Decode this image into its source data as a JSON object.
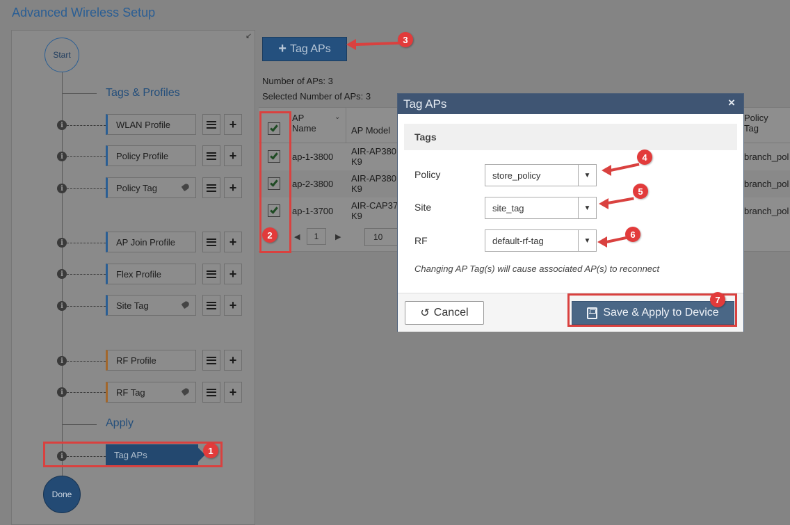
{
  "page": {
    "title": "Advanced Wireless Setup"
  },
  "wizard": {
    "start_label": "Start",
    "done_label": "Done",
    "sections": {
      "tags_profiles": "Tags & Profiles",
      "apply": "Apply"
    },
    "steps": [
      {
        "label": "WLAN Profile",
        "accent": "#2a5e94",
        "tag_icon": false
      },
      {
        "label": "Policy Profile",
        "accent": "#2a5e94",
        "tag_icon": false
      },
      {
        "label": "Policy Tag",
        "accent": "#2a5e94",
        "tag_icon": true
      },
      {
        "label": "AP Join Profile",
        "accent": "#2a5e94",
        "tag_icon": false
      },
      {
        "label": "Flex Profile",
        "accent": "#2a5e94",
        "tag_icon": false
      },
      {
        "label": "Site Tag",
        "accent": "#2a5e94",
        "tag_icon": true
      },
      {
        "label": "RF Profile",
        "accent": "#a2672c",
        "tag_icon": false
      },
      {
        "label": "RF Tag",
        "accent": "#a2672c",
        "tag_icon": true
      }
    ],
    "active_step": "Tag APs",
    "step_info_icon": "i"
  },
  "main": {
    "tag_aps_button": "Tag APs",
    "ap_count": "Number of APs: 3",
    "selected_count": "Selected Number of APs: 3",
    "table": {
      "headers": {
        "ap_name_line1": "AP",
        "ap_name_line2": "Name",
        "ap_model": "AP Model",
        "policy_tag_line1": "Policy",
        "policy_tag_line2": "Tag"
      },
      "rows": [
        {
          "name": "ap-1-3800",
          "model_line1": "AIR-AP380",
          "model_line2": "K9",
          "policy_tag": "branch_pol",
          "checked": true
        },
        {
          "name": "ap-2-3800",
          "model_line1": "AIR-AP380",
          "model_line2": "K9",
          "policy_tag": "branch_pol",
          "checked": true
        },
        {
          "name": "ap-1-3700",
          "model_line1": "AIR-CAP37",
          "model_line2": "K9",
          "policy_tag": "branch_pol",
          "checked": true
        }
      ],
      "pagination": {
        "page": "1",
        "per_page": "10"
      }
    }
  },
  "modal": {
    "title": "Tag APs",
    "close": "×",
    "section_label": "Tags",
    "fields": {
      "policy_label": "Policy",
      "policy_value": "store_policy",
      "site_label": "Site",
      "site_value": "site_tag",
      "rf_label": "RF",
      "rf_value": "default-rf-tag"
    },
    "note": "Changing AP Tag(s) will cause associated AP(s) to reconnect",
    "cancel_label": "Cancel",
    "save_label": "Save & Apply to Device"
  },
  "annotations": {
    "badges": [
      "1",
      "2",
      "3",
      "4",
      "5",
      "6",
      "7"
    ],
    "color": "#d9413f"
  }
}
